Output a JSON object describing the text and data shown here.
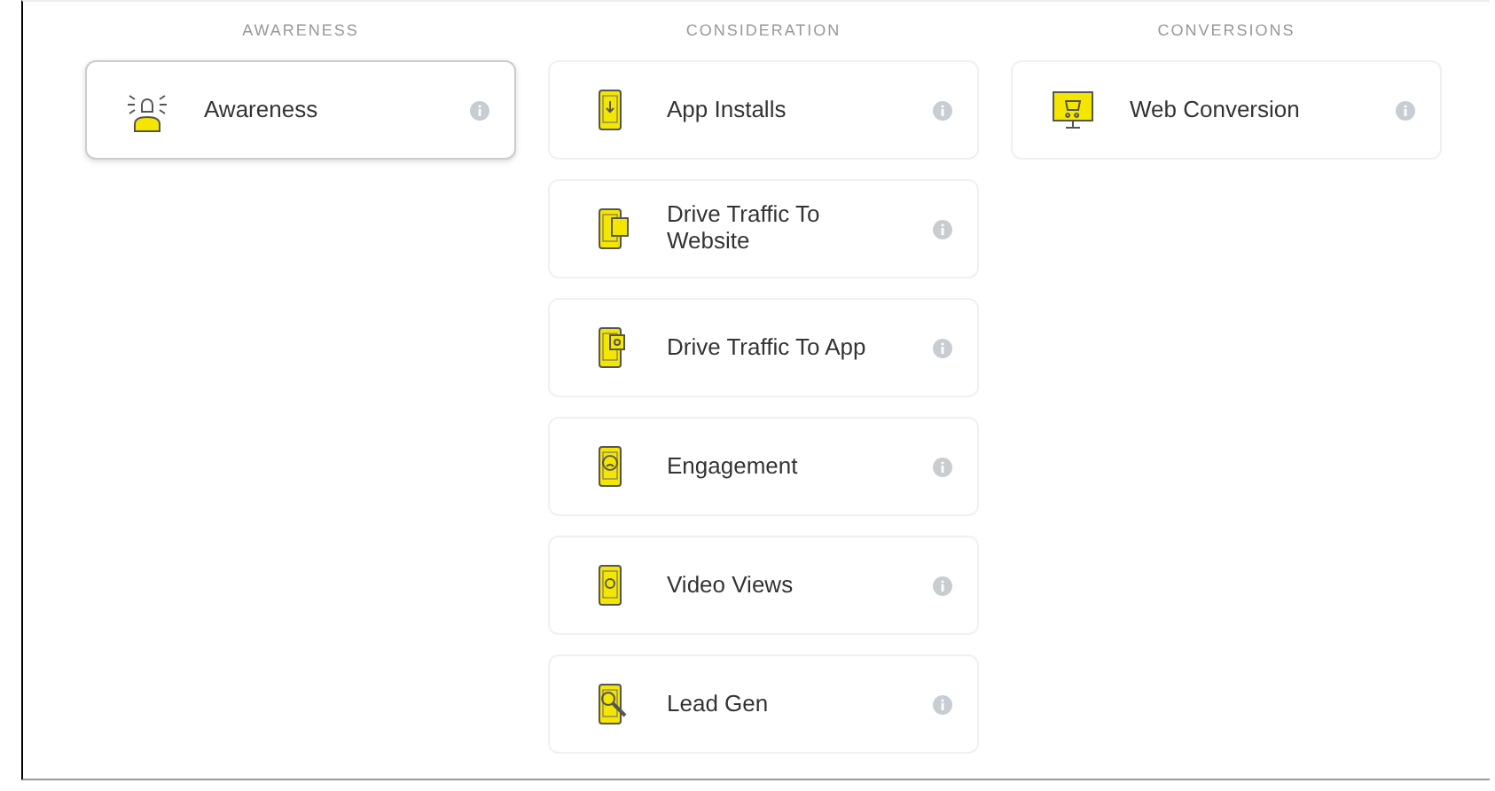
{
  "columns": [
    {
      "heading": "AWARENESS",
      "objectives": [
        {
          "label": "Awareness",
          "selected": true
        }
      ]
    },
    {
      "heading": "CONSIDERATION",
      "objectives": [
        {
          "label": "App Installs",
          "selected": false
        },
        {
          "label": "Drive Traffic To Website",
          "selected": false
        },
        {
          "label": "Drive Traffic To App",
          "selected": false
        },
        {
          "label": "Engagement",
          "selected": false
        },
        {
          "label": "Video Views",
          "selected": false
        },
        {
          "label": "Lead Gen",
          "selected": false
        }
      ]
    },
    {
      "heading": "CONVERSIONS",
      "objectives": [
        {
          "label": "Web Conversion",
          "selected": false
        }
      ]
    }
  ]
}
